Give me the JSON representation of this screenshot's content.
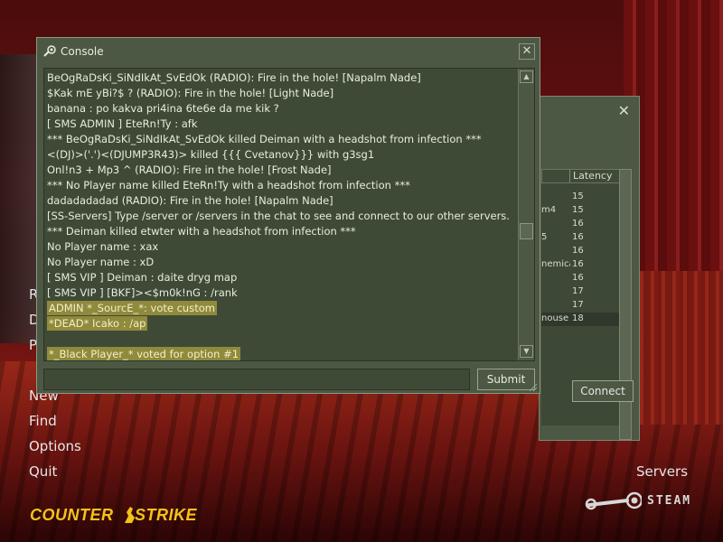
{
  "menu": {
    "partial_items": [
      "R",
      "D",
      "P",
      "New"
    ],
    "items": [
      "Find",
      "Options",
      "Quit"
    ]
  },
  "servers_link": "Servers",
  "steam_label": "STEAM",
  "logo_text": "COUNTER STRIKE",
  "server_browser": {
    "column_latency": "Latency",
    "rows": [
      {
        "name": "",
        "latency": "15"
      },
      {
        "name": "m4",
        "latency": "15"
      },
      {
        "name": "",
        "latency": "16"
      },
      {
        "name": "5",
        "latency": "16"
      },
      {
        "name": "",
        "latency": "16"
      },
      {
        "name": "nemica",
        "latency": "16"
      },
      {
        "name": "",
        "latency": "16"
      },
      {
        "name": "",
        "latency": "17"
      },
      {
        "name": "",
        "latency": "17"
      },
      {
        "name": "nouse",
        "latency": "18"
      }
    ],
    "connect_label": "Connect"
  },
  "console": {
    "title": "Console",
    "lines": [
      "BeOgRaDsKi_SiNdIkAt_SvEdOk (RADIO): Fire in the hole! [Napalm Nade]",
      "$Kak mE yBi?$ ? (RADIO): Fire in the hole! [Light Nade]",
      "banana : po kakva pri4ina 6te6e da me kik ?",
      "[ SMS ADMIN ] EteRn!Ty : afk",
      "*** BeOgRaDsKi_SiNdIkAt_SvEdOk killed Deiman with a headshot from infection ***",
      "<(DJ)>('.')<(DJUMP3R43)> killed {{{ Cvetanov}}} with g3sg1",
      "Onl!n3 + Mp3 ^ (RADIO): Fire in the hole! [Frost Nade]",
      "*** No Player name killed EteRn!Ty with a headshot from infection ***",
      "dadadadadad (RADIO): Fire in the hole! [Napalm Nade]",
      "[SS-Servers] Type /server or /servers in the chat to see and connect to our other servers.",
      "*** Deiman killed etwter with a headshot from infection ***",
      "No Player name : xax",
      "No Player name : xD",
      "[ SMS VIP ] Deiman : daite dryg map",
      "[ SMS VIP ] [BKF]><$m0k!nG : /rank",
      "ADMIN *_SourcE_*: vote custom",
      "*DEAD* Icako :  /ap",
      "",
      "*_Black Player_* voted for option #1"
    ],
    "input_value": "",
    "submit_label": "Submit"
  },
  "colors": {
    "panel": "#4c5844",
    "panel_dark": "#3e4a36",
    "highlight": "#8f8a3c",
    "logo_yellow": "#f0c419"
  }
}
